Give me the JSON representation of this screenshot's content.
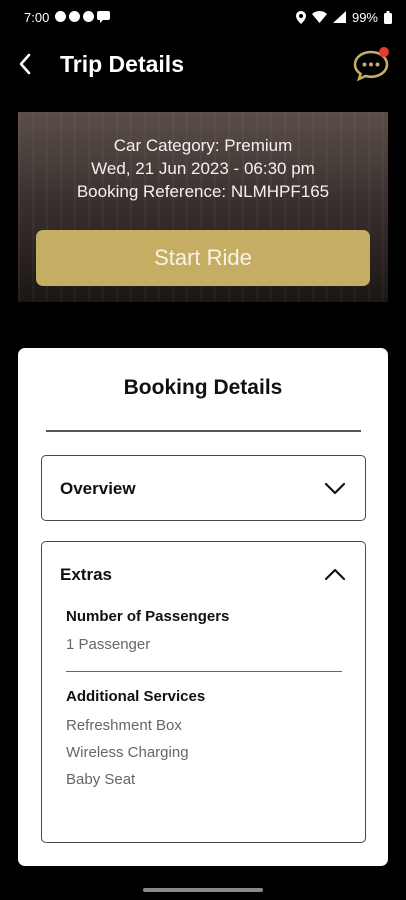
{
  "status_bar": {
    "time": "7:00",
    "battery": "99%"
  },
  "header": {
    "title": "Trip Details",
    "back_icon": "chevron-left-icon",
    "chat_icon": "chat-bubble-icon",
    "notification_dot_color": "#e53935"
  },
  "banner": {
    "car_category": "Car Category: Premium",
    "datetime": "Wed, 21 Jun 2023 - 06:30 pm",
    "booking_reference": "Booking Reference: NLMHPF165",
    "start_button_label": "Start Ride",
    "accent_color": "#c5ae63"
  },
  "booking": {
    "title": "Booking Details",
    "overview": {
      "label": "Overview",
      "expanded": false
    },
    "extras": {
      "label": "Extras",
      "expanded": true,
      "passengers_label": "Number of Passengers",
      "passengers_value": "1 Passenger",
      "services_label": "Additional Services",
      "services": [
        "Refreshment Box",
        "Wireless Charging",
        "Baby Seat"
      ]
    }
  }
}
